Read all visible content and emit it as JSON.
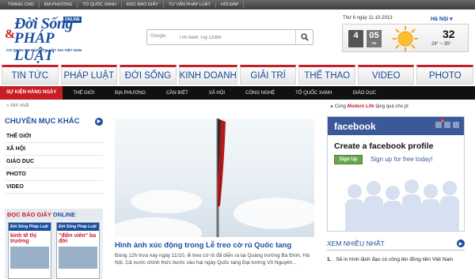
{
  "topbar": [
    "TRANG CHỦ",
    "ĐỊA PHƯƠNG",
    "TỔ QUỐC XANH",
    "ĐỌC BÁO GIẤY",
    "TƯ VẤN PHÁP LUẬT",
    "HỎI ĐÁP"
  ],
  "logo": {
    "line1": "Đời Sống",
    "amp": "&",
    "line2": "PHÁP LUẬT",
    "badge": "ONLINE",
    "sub": "CƠ QUAN TW CỦA HỘI LUẬT GIA VIỆT NAM"
  },
  "search": {
    "brand": "Google",
    "placeholder": "Tìm kiếm Tùy Chỉnh",
    "icon": "search-icon"
  },
  "weather": {
    "date": "Thứ 6 ngày 11-10-2013",
    "city": "Hà Nội ▾",
    "hour": "4",
    "minute": "05",
    "ampm": "PM",
    "temp": "32",
    "range": "24° ~ 35°",
    "icon": "sun-icon"
  },
  "categories": [
    "TIN TỨC",
    "PHÁP LUẬT",
    "ĐỜI SỐNG",
    "KINH DOANH",
    "GIẢI TRÍ",
    "THỂ THAO",
    "VIDEO",
    "PHOTO"
  ],
  "subnav": [
    "SỰ KIỆN HÀNG NGÀY",
    "THẾ GIỚI",
    "ĐỊA PHƯƠNG",
    "CẦN BIẾT",
    "XÃ HỘI",
    "CÔNG NGHỆ",
    "TỔ QUỐC XANH",
    "GIÁO DỤC"
  ],
  "crumb": "Mới nhất",
  "follow": {
    "prefix": "▸ Cùng ",
    "brand": "Modern Life",
    "suffix": " tặng quà cho pt"
  },
  "left": {
    "title": "CHUYÊN MỤC KHÁC",
    "items": [
      "THẾ GIỚI",
      "XÃ HỘI",
      "GIÁO DỤC",
      "PHOTO",
      "VIDEO"
    ]
  },
  "paper": {
    "title_red": "ĐỌC BÁO GIẤY ",
    "title_blue": "ONLINE",
    "cover1": {
      "mast": "Đời Sống Pháp Luật",
      "headline": "kinh tế thị trường"
    },
    "cover2": {
      "mast": "Đời Sống Pháp Luật",
      "headline": "\"điền viên\" ba đời"
    }
  },
  "article": {
    "title": "Hình ảnh xúc động trong Lễ treo cờ rủ Quốc tang",
    "desc": "Đúng 12h trưa nay ngày 11/10, lễ treo cờ rủ đã diễn ra tại Quảng trường Ba Đình, Hà Nội. Cả nước chính thức bước vào hai ngày Quốc tang Đại tướng Võ Nguyên..."
  },
  "facebook": {
    "brand": "facebook",
    "badge": "2",
    "heading": "Create a facebook profile",
    "signup": "Sign Up",
    "free": "Sign up for free today!"
  },
  "most": {
    "title": "XEM NHIỀU NHẤT",
    "items": [
      {
        "num": "1.",
        "text": "Sẽ in hình lãnh đạo có công lên đồng tiền Việt Nam"
      }
    ]
  },
  "colors": {
    "accent": "#c81d25",
    "brand": "#1b4fa0",
    "facebook": "#3b5998"
  }
}
